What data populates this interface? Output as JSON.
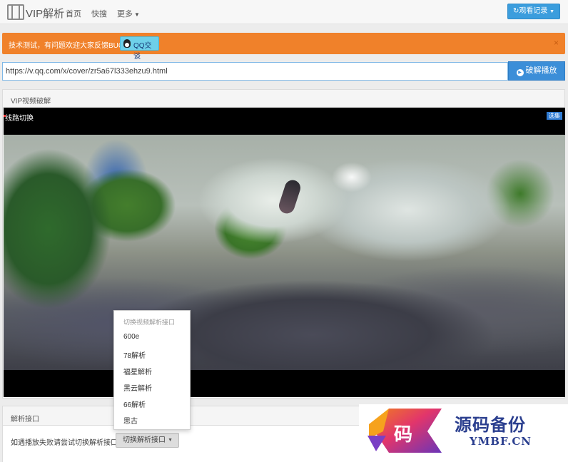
{
  "navbar": {
    "logo_text": "VIP解析",
    "links": [
      "首页",
      "快搜",
      "更多"
    ],
    "history_button": "观看记录"
  },
  "alert": {
    "text": "技术测试，有问题欢迎大家反馈BUG!",
    "qq_badge": "QQ交谈",
    "close": "×"
  },
  "search": {
    "url_value": "https://v.qq.com/x/cover/zr5a67l333ehzu9.html",
    "parse_button": "破解播放"
  },
  "panel": {
    "title": "VIP视频破解"
  },
  "player": {
    "route_label": "线路切换",
    "episode_button": "选集"
  },
  "dropdown": {
    "header": "切换视频解析接口",
    "items": [
      "600e",
      "78解析",
      "福星解析",
      "黑云解析",
      "66解析",
      "思古"
    ]
  },
  "interface_panel": {
    "title": "解析接口",
    "hint": "如遇播放失败请尝试切换解析接口",
    "switch_button": "切换解析接口"
  },
  "watermark": {
    "char": "码",
    "name_cn": "源码备份",
    "name_en": "YMBF.CN"
  }
}
